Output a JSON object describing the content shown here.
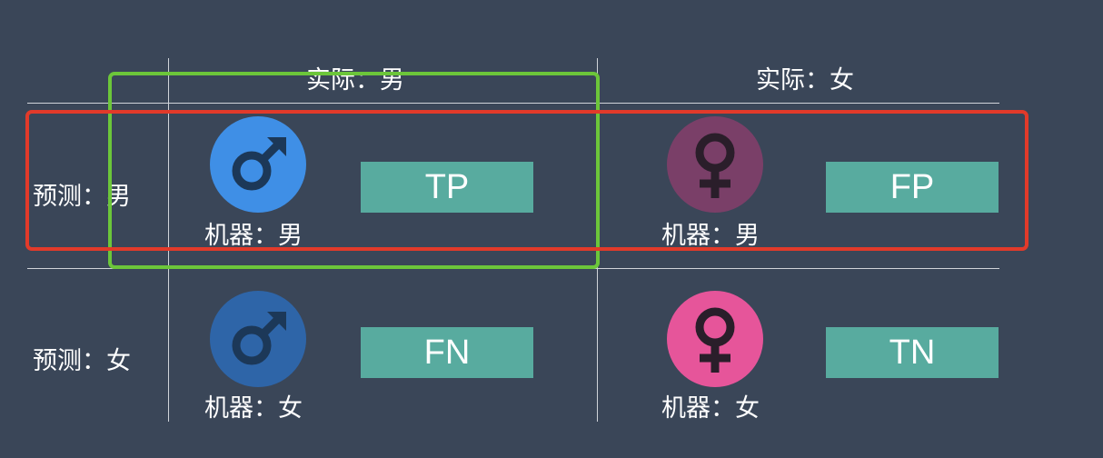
{
  "headers": {
    "col_actual_male": "实际：男",
    "col_actual_female": "实际：女",
    "row_pred_male": "预测：男",
    "row_pred_female": "预测：女"
  },
  "cells": {
    "tp": {
      "icon": "male-symbol-icon",
      "icon_color": "#3f8fe6",
      "label": "机器：男",
      "badge": "TP"
    },
    "fp": {
      "icon": "female-symbol-icon",
      "icon_color": "#7a3f68",
      "label": "机器：男",
      "badge": "FP"
    },
    "fn": {
      "icon": "male-symbol-icon",
      "icon_color": "#2e65a8",
      "label": "机器：女",
      "badge": "FN"
    },
    "tn": {
      "icon": "female-symbol-icon",
      "icon_color": "#e6559a",
      "label": "机器：女",
      "badge": "TN"
    }
  },
  "colors": {
    "background": "#3a4658",
    "badge": "#58ab9f",
    "green_highlight": "#6cc63a",
    "red_highlight": "#e23a2a"
  }
}
